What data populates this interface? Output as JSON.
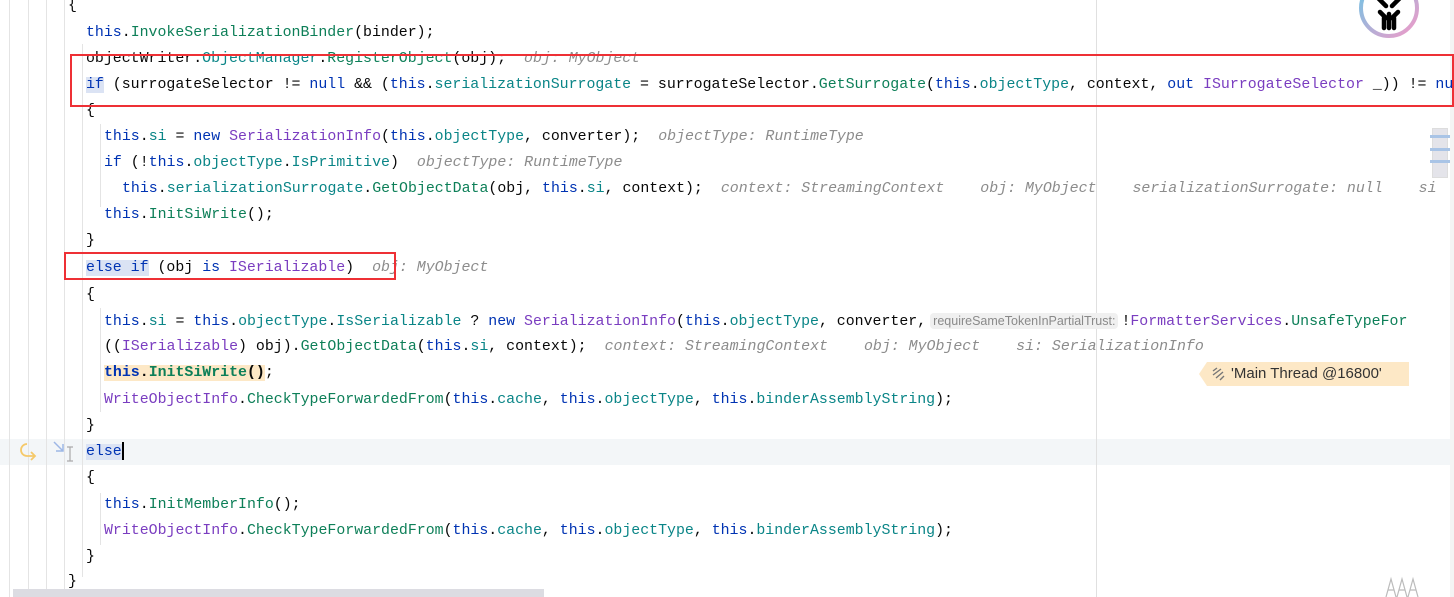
{
  "code": {
    "lines": [
      {
        "tokens": [
          {
            "t": "{",
            "k": "t"
          }
        ]
      },
      {
        "tokens": [
          {
            "t": "this",
            "k": "kw"
          },
          {
            "t": ".",
            "k": "t"
          },
          {
            "t": "InvokeSerializationBinder",
            "k": "m"
          },
          {
            "t": "(binder);",
            "k": "t"
          }
        ]
      },
      {
        "tokens": [
          {
            "t": "objectWriter.",
            "k": "t"
          },
          {
            "t": "ObjectManager",
            "k": "f"
          },
          {
            "t": ".",
            "k": "t"
          },
          {
            "t": "RegisterObject",
            "k": "m"
          },
          {
            "t": "(obj);",
            "k": "t"
          },
          {
            "t": "obj: MyObject",
            "k": "h"
          }
        ]
      },
      {
        "tokens": [
          {
            "t": "if",
            "k": "kw",
            "hl": true
          },
          {
            "t": " (surrogateSelector != ",
            "k": "t"
          },
          {
            "t": "null",
            "k": "kw"
          },
          {
            "t": " && (",
            "k": "t"
          },
          {
            "t": "this",
            "k": "kw"
          },
          {
            "t": ".",
            "k": "t"
          },
          {
            "t": "serializationSurrogate",
            "k": "f"
          },
          {
            "t": " = surrogateSelector.",
            "k": "t"
          },
          {
            "t": "GetSurrogate",
            "k": "m"
          },
          {
            "t": "(",
            "k": "t"
          },
          {
            "t": "this",
            "k": "kw"
          },
          {
            "t": ".",
            "k": "t"
          },
          {
            "t": "objectType",
            "k": "f"
          },
          {
            "t": ", context, ",
            "k": "t"
          },
          {
            "t": "out",
            "k": "kw"
          },
          {
            "t": " ",
            "k": "t"
          },
          {
            "t": "ISurrogateSelector",
            "k": "c"
          },
          {
            "t": " _)) != ",
            "k": "t"
          },
          {
            "t": "null",
            "k": "kw"
          }
        ]
      },
      {
        "tokens": [
          {
            "t": "{",
            "k": "t"
          }
        ]
      },
      {
        "tokens": [
          {
            "t": "this",
            "k": "kw"
          },
          {
            "t": ".",
            "k": "t"
          },
          {
            "t": "si",
            "k": "f"
          },
          {
            "t": " = ",
            "k": "t"
          },
          {
            "t": "new",
            "k": "kw"
          },
          {
            "t": " ",
            "k": "t"
          },
          {
            "t": "SerializationInfo",
            "k": "c"
          },
          {
            "t": "(",
            "k": "t"
          },
          {
            "t": "this",
            "k": "kw"
          },
          {
            "t": ".",
            "k": "t"
          },
          {
            "t": "objectType",
            "k": "f"
          },
          {
            "t": ", converter);",
            "k": "t"
          },
          {
            "t": "objectType: RuntimeType",
            "k": "h"
          }
        ]
      },
      {
        "tokens": [
          {
            "t": "if",
            "k": "kw"
          },
          {
            "t": " (!",
            "k": "t"
          },
          {
            "t": "this",
            "k": "kw"
          },
          {
            "t": ".",
            "k": "t"
          },
          {
            "t": "objectType",
            "k": "f"
          },
          {
            "t": ".",
            "k": "t"
          },
          {
            "t": "IsPrimitive",
            "k": "f"
          },
          {
            "t": ")",
            "k": "t"
          },
          {
            "t": "objectType: RuntimeType",
            "k": "h"
          }
        ]
      },
      {
        "tokens": [
          {
            "t": "this",
            "k": "kw"
          },
          {
            "t": ".",
            "k": "t"
          },
          {
            "t": "serializationSurrogate",
            "k": "f"
          },
          {
            "t": ".",
            "k": "t"
          },
          {
            "t": "GetObjectData",
            "k": "m"
          },
          {
            "t": "(obj, ",
            "k": "t"
          },
          {
            "t": "this",
            "k": "kw"
          },
          {
            "t": ".",
            "k": "t"
          },
          {
            "t": "si",
            "k": "f"
          },
          {
            "t": ", context);",
            "k": "t"
          },
          {
            "t": "context: StreamingContext",
            "k": "h"
          },
          {
            "t": "obj: MyObject",
            "k": "h"
          },
          {
            "t": "serializationSurrogate: null",
            "k": "h"
          },
          {
            "t": "si",
            "k": "h"
          }
        ]
      },
      {
        "tokens": [
          {
            "t": "this",
            "k": "kw"
          },
          {
            "t": ".",
            "k": "t"
          },
          {
            "t": "InitSiWrite",
            "k": "m"
          },
          {
            "t": "();",
            "k": "t"
          }
        ]
      },
      {
        "tokens": [
          {
            "t": "}",
            "k": "t"
          }
        ]
      },
      {
        "tokens": [
          {
            "t": "else if",
            "k": "kw",
            "hl": true
          },
          {
            "t": " (obj ",
            "k": "t"
          },
          {
            "t": "is",
            "k": "kw"
          },
          {
            "t": " ",
            "k": "t"
          },
          {
            "t": "ISerializable",
            "k": "c"
          },
          {
            "t": ")",
            "k": "t"
          },
          {
            "t": "obj: MyObject",
            "k": "h"
          }
        ]
      },
      {
        "tokens": [
          {
            "t": "{",
            "k": "t"
          }
        ]
      },
      {
        "tokens": [
          {
            "t": "this",
            "k": "kw"
          },
          {
            "t": ".",
            "k": "t"
          },
          {
            "t": "si",
            "k": "f"
          },
          {
            "t": " = ",
            "k": "t"
          },
          {
            "t": "this",
            "k": "kw"
          },
          {
            "t": ".",
            "k": "t"
          },
          {
            "t": "objectType",
            "k": "f"
          },
          {
            "t": ".",
            "k": "t"
          },
          {
            "t": "IsSerializable",
            "k": "f"
          },
          {
            "t": " ? ",
            "k": "t"
          },
          {
            "t": "new",
            "k": "kw"
          },
          {
            "t": " ",
            "k": "t"
          },
          {
            "t": "SerializationInfo",
            "k": "c"
          },
          {
            "t": "(",
            "k": "t"
          },
          {
            "t": "this",
            "k": "kw"
          },
          {
            "t": ".",
            "k": "t"
          },
          {
            "t": "objectType",
            "k": "f"
          },
          {
            "t": ", converter,",
            "k": "t"
          },
          {
            "t": "requireSameTokenInPartialTrust:",
            "k": "pill"
          },
          {
            "t": "!",
            "k": "t"
          },
          {
            "t": "FormatterServices",
            "k": "c"
          },
          {
            "t": ".",
            "k": "t"
          },
          {
            "t": "UnsafeTypeFor",
            "k": "m"
          }
        ]
      },
      {
        "tokens": [
          {
            "t": "((",
            "k": "t"
          },
          {
            "t": "ISerializable",
            "k": "c"
          },
          {
            "t": ") obj).",
            "k": "t"
          },
          {
            "t": "GetObjectData",
            "k": "m"
          },
          {
            "t": "(",
            "k": "t"
          },
          {
            "t": "this",
            "k": "kw"
          },
          {
            "t": ".",
            "k": "t"
          },
          {
            "t": "si",
            "k": "f"
          },
          {
            "t": ", context);",
            "k": "t"
          },
          {
            "t": "context: StreamingContext",
            "k": "h"
          },
          {
            "t": "obj: MyObject",
            "k": "h"
          },
          {
            "t": "si: SerializationInfo",
            "k": "h"
          }
        ]
      },
      {
        "exec": true,
        "tokens": [
          {
            "t": "this",
            "k": "kw"
          },
          {
            "t": ".",
            "k": "t"
          },
          {
            "t": "InitSiWrite",
            "k": "m"
          },
          {
            "t": "()",
            "k": "t"
          }
        ],
        "tail": ";"
      },
      {
        "tokens": [
          {
            "t": "WriteObjectInfo",
            "k": "c"
          },
          {
            "t": ".",
            "k": "t"
          },
          {
            "t": "CheckTypeForwardedFrom",
            "k": "m"
          },
          {
            "t": "(",
            "k": "t"
          },
          {
            "t": "this",
            "k": "kw"
          },
          {
            "t": ".",
            "k": "t"
          },
          {
            "t": "cache",
            "k": "f"
          },
          {
            "t": ", ",
            "k": "t"
          },
          {
            "t": "this",
            "k": "kw"
          },
          {
            "t": ".",
            "k": "t"
          },
          {
            "t": "objectType",
            "k": "f"
          },
          {
            "t": ", ",
            "k": "t"
          },
          {
            "t": "this",
            "k": "kw"
          },
          {
            "t": ".",
            "k": "t"
          },
          {
            "t": "binderAssemblyString",
            "k": "f"
          },
          {
            "t": ");",
            "k": "t"
          }
        ]
      },
      {
        "tokens": [
          {
            "t": "}",
            "k": "t"
          }
        ]
      },
      {
        "caret": true,
        "tokens": [
          {
            "t": "else",
            "k": "kw",
            "hl": true
          }
        ]
      },
      {
        "tokens": [
          {
            "t": "{",
            "k": "t"
          }
        ]
      },
      {
        "tokens": [
          {
            "t": "this",
            "k": "kw"
          },
          {
            "t": ".",
            "k": "t"
          },
          {
            "t": "InitMemberInfo",
            "k": "m"
          },
          {
            "t": "();",
            "k": "t"
          }
        ]
      },
      {
        "tokens": [
          {
            "t": "WriteObjectInfo",
            "k": "c"
          },
          {
            "t": ".",
            "k": "t"
          },
          {
            "t": "CheckTypeForwardedFrom",
            "k": "m"
          },
          {
            "t": "(",
            "k": "t"
          },
          {
            "t": "this",
            "k": "kw"
          },
          {
            "t": ".",
            "k": "t"
          },
          {
            "t": "cache",
            "k": "f"
          },
          {
            "t": ", ",
            "k": "t"
          },
          {
            "t": "this",
            "k": "kw"
          },
          {
            "t": ".",
            "k": "t"
          },
          {
            "t": "objectType",
            "k": "f"
          },
          {
            "t": ", ",
            "k": "t"
          },
          {
            "t": "this",
            "k": "kw"
          },
          {
            "t": ".",
            "k": "t"
          },
          {
            "t": "binderAssemblyString",
            "k": "f"
          },
          {
            "t": ");",
            "k": "t"
          }
        ]
      },
      {
        "tokens": [
          {
            "t": "}",
            "k": "t"
          }
        ]
      },
      {
        "tokens": [
          {
            "t": "}",
            "k": "t"
          }
        ]
      }
    ]
  },
  "debugger": {
    "thread_label": "'Main Thread @16800'",
    "gutter_icons": [
      "step-over-arrow-icon",
      "run-to-cursor-icon",
      "text-cursor-icon"
    ]
  },
  "annotations": {
    "highlight_color": "#ee3035"
  },
  "reader_mode_icon": "AAA-font-icon"
}
